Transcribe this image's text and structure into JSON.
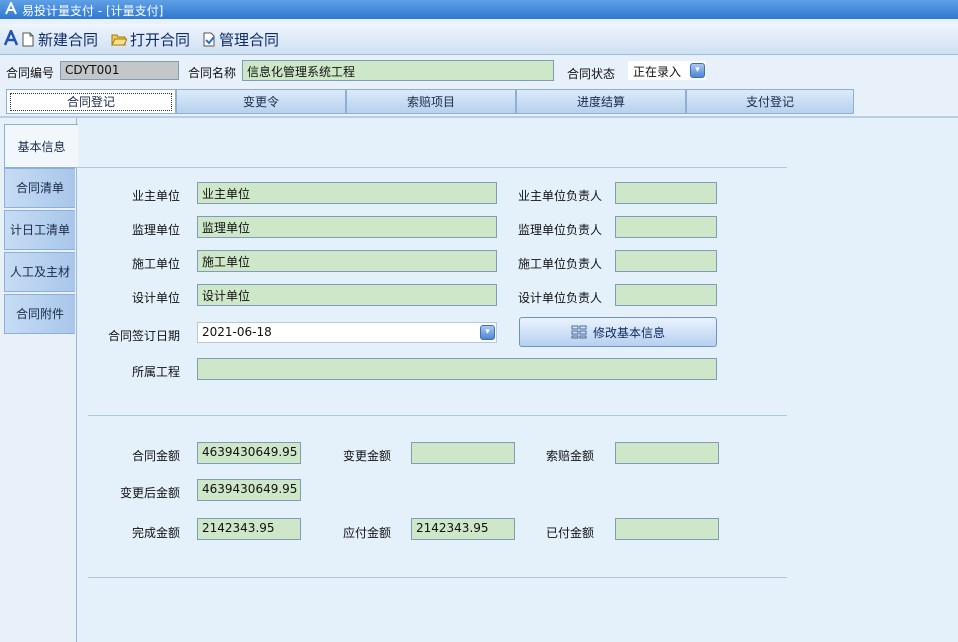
{
  "window": {
    "title": "易投计量支付 - [计量支付]"
  },
  "toolbar": {
    "new_contract": "新建合同",
    "open_contract": "打开合同",
    "manage_contract": "管理合同"
  },
  "header": {
    "contract_no_label": "合同编号",
    "contract_no": "CDYT001",
    "contract_name_label": "合同名称",
    "contract_name": "信息化管理系统工程",
    "contract_status_label": "合同状态",
    "contract_status": "正在录入"
  },
  "tabs": [
    "合同登记",
    "变更令",
    "索赔项目",
    "进度结算",
    "支付登记"
  ],
  "side_tabs": [
    "基本信息",
    "合同清单",
    "计日工清单",
    "人工及主材",
    "合同附件"
  ],
  "form": {
    "owner_label": "业主单位",
    "owner": "业主单位",
    "owner_rep_label": "业主单位负责人",
    "owner_rep": "",
    "supervisor_label": "监理单位",
    "supervisor": "监理单位",
    "supervisor_rep_label": "监理单位负责人",
    "supervisor_rep": "",
    "constructor_label": "施工单位",
    "constructor": "施工单位",
    "constructor_rep_label": "施工单位负责人",
    "constructor_rep": "",
    "designer_label": "设计单位",
    "designer": "设计单位",
    "designer_rep_label": "设计单位负责人",
    "designer_rep": "",
    "sign_date_label": "合同签订日期",
    "sign_date": "2021-06-18",
    "modify_button": "修改基本信息",
    "project_label": "所属工程",
    "project": ""
  },
  "amounts": {
    "contract_amount_label": "合同金额",
    "contract_amount": "4639430649.95",
    "change_amount_label": "变更金额",
    "change_amount": "",
    "claim_amount_label": "索赔金额",
    "claim_amount": "",
    "after_change_label": "变更后金额",
    "after_change": "4639430649.95",
    "completed_label": "完成金额",
    "completed": "2142343.95",
    "payable_label": "应付金额",
    "payable": "2142343.95",
    "paid_label": "已付金额",
    "paid": ""
  }
}
